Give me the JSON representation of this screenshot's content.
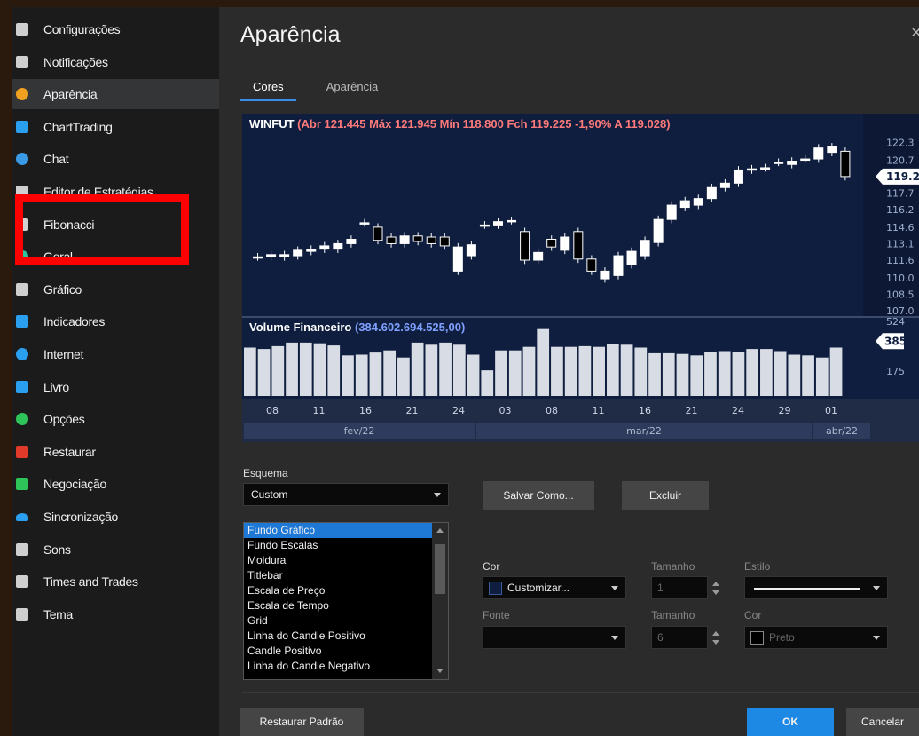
{
  "sidebar": {
    "items": [
      {
        "label": "Configurações",
        "icon": "gear-icon",
        "color": "#cfcfcf"
      },
      {
        "label": "Notificações",
        "icon": "alarm-clock-icon",
        "color": "#cfcfcf"
      },
      {
        "label": "Aparência",
        "icon": "palette-icon",
        "color": "#f0a020",
        "active": true
      },
      {
        "label": "ChartTrading",
        "icon": "chart-trading-icon",
        "color": "#2a9ff0"
      },
      {
        "label": "Chat",
        "icon": "chat-icon",
        "color": "#3a9ae6"
      },
      {
        "label": "Editor de Estratégias",
        "icon": "strategy-editor-icon",
        "color": "#cfcfcf"
      },
      {
        "label": "Fibonacci",
        "icon": "fibonacci-icon",
        "color": "#d0d0d0"
      },
      {
        "label": "Geral",
        "icon": "general-icon",
        "color": "#2ec4a0"
      },
      {
        "label": "Gráfico",
        "icon": "chart-icon",
        "color": "#cfcfcf"
      },
      {
        "label": "Indicadores",
        "icon": "indicators-icon",
        "color": "#2a9ff0"
      },
      {
        "label": "Internet",
        "icon": "globe-icon",
        "color": "#2a9ff0"
      },
      {
        "label": "Livro",
        "icon": "book-icon",
        "color": "#2a9ff0"
      },
      {
        "label": "Opções",
        "icon": "options-icon",
        "color": "#2ec45a"
      },
      {
        "label": "Restaurar",
        "icon": "restore-icon",
        "color": "#e03a2a"
      },
      {
        "label": "Negociação",
        "icon": "trade-icon",
        "color": "#2ec45a"
      },
      {
        "label": "Sincronização",
        "icon": "cloud-icon",
        "color": "#2a9ff0"
      },
      {
        "label": "Sons",
        "icon": "speaker-icon",
        "color": "#cfcfcf"
      },
      {
        "label": "Times and Trades",
        "icon": "times-trades-icon",
        "color": "#cfcfcf"
      },
      {
        "label": "Tema",
        "icon": "monitor-icon",
        "color": "#cfcfcf"
      }
    ]
  },
  "main": {
    "title": "Aparência",
    "close": "×",
    "tabs": [
      {
        "label": "Cores",
        "active": true
      },
      {
        "label": "Aparência",
        "active": false
      }
    ]
  },
  "chart_data": [
    {
      "type": "candlestick",
      "title_symbol": "WINFUT",
      "title_text": "(Abr 121.445 Máx 121.945 Mín 118.800 Fch 119.225 -1,90% A 119.028)",
      "y_ticks": [
        "122.3",
        "120.7",
        "117.7",
        "116.2",
        "114.6",
        "113.1",
        "111.6",
        "110.0",
        "108.5",
        "107.0"
      ],
      "y_current": "119.2",
      "ylim": [
        107.0,
        122.5
      ],
      "candles": [
        {
          "o": 111.9,
          "c": 111.9
        },
        {
          "o": 111.9,
          "c": 112.1
        },
        {
          "o": 111.9,
          "c": 112.1
        },
        {
          "o": 112.0,
          "c": 112.5
        },
        {
          "o": 112.4,
          "c": 112.6
        },
        {
          "o": 112.6,
          "c": 112.9
        },
        {
          "o": 112.6,
          "c": 113.1
        },
        {
          "o": 113.1,
          "c": 113.5
        },
        {
          "o": 115.0,
          "c": 115.0
        },
        {
          "o": 114.6,
          "c": 113.4
        },
        {
          "o": 113.7,
          "c": 113.1
        },
        {
          "o": 113.1,
          "c": 113.8
        },
        {
          "o": 113.8,
          "c": 113.3
        },
        {
          "o": 113.7,
          "c": 113.1
        },
        {
          "o": 113.7,
          "c": 112.9
        },
        {
          "o": 110.6,
          "c": 112.8
        },
        {
          "o": 112.0,
          "c": 113.0
        },
        {
          "o": 114.8,
          "c": 114.8
        },
        {
          "o": 114.8,
          "c": 115.1
        },
        {
          "o": 115.2,
          "c": 115.2
        },
        {
          "o": 114.2,
          "c": 111.6
        },
        {
          "o": 111.6,
          "c": 112.3
        },
        {
          "o": 113.5,
          "c": 112.8
        },
        {
          "o": 112.5,
          "c": 113.7
        },
        {
          "o": 114.2,
          "c": 111.7
        },
        {
          "o": 111.7,
          "c": 110.6
        },
        {
          "o": 109.9,
          "c": 110.6
        },
        {
          "o": 110.2,
          "c": 112.0
        },
        {
          "o": 111.2,
          "c": 112.4
        },
        {
          "o": 112.0,
          "c": 113.4
        },
        {
          "o": 113.2,
          "c": 115.3
        },
        {
          "o": 115.3,
          "c": 116.6
        },
        {
          "o": 116.4,
          "c": 117.0
        },
        {
          "o": 116.6,
          "c": 117.2
        },
        {
          "o": 117.2,
          "c": 118.2
        },
        {
          "o": 118.2,
          "c": 118.6
        },
        {
          "o": 118.6,
          "c": 119.8
        },
        {
          "o": 119.8,
          "c": 119.9
        },
        {
          "o": 120.0,
          "c": 120.0
        },
        {
          "o": 120.5,
          "c": 120.5
        },
        {
          "o": 120.3,
          "c": 120.6
        },
        {
          "o": 120.8,
          "c": 120.8
        },
        {
          "o": 120.8,
          "c": 121.8
        },
        {
          "o": 121.4,
          "c": 121.9
        },
        {
          "o": 121.5,
          "c": 119.2
        }
      ]
    },
    {
      "type": "bar",
      "title_name": "Volume Financeiro",
      "title_value": "(384.602.694.525,00)",
      "y_ticks": [
        "524",
        "175"
      ],
      "y_current": "385",
      "ylim": [
        0,
        524
      ],
      "values": [
        340,
        330,
        350,
        375,
        375,
        370,
        355,
        285,
        290,
        305,
        320,
        270,
        375,
        360,
        375,
        360,
        290,
        180,
        320,
        320,
        345,
        470,
        345,
        345,
        350,
        345,
        365,
        360,
        340,
        300,
        300,
        295,
        285,
        310,
        315,
        310,
        330,
        330,
        315,
        290,
        285,
        270,
        340,
        0
      ]
    }
  ],
  "x_ticks": [
    "08",
    "11",
    "16",
    "21",
    "24",
    "03",
    "08",
    "11",
    "16",
    "21",
    "24",
    "29",
    "01"
  ],
  "x_months": [
    "fev/22",
    "mar/22",
    "abr/22"
  ],
  "colors": {
    "accent": "#1e78d6",
    "chart_bg": "#0f1e3e",
    "candle_up": "#ffffff",
    "candle_down": "#000000",
    "volume_bar": "#d8dce4",
    "price_label": "#ff6a6a",
    "ok_button": "#1e88e5"
  },
  "form": {
    "schema_label": "Esquema",
    "schema_value": "Custom",
    "save_as": "Salvar Como...",
    "delete": "Excluir",
    "list_items": [
      "Fundo Gráfico",
      "Fundo Escalas",
      "Moldura",
      "Titlebar",
      "Escala de Preço",
      "Escala de Tempo",
      "Grid",
      "Linha do Candle Positivo",
      "Candle Positivo",
      "Linha do Candle Negativo"
    ],
    "color_label": "Cor",
    "color_value": "Customizar...",
    "size_label": "Tamanho",
    "size_value": "1",
    "style_label": "Estilo",
    "font_label": "Fonte",
    "font_size_label": "Tamanho",
    "font_size_value": "6",
    "font_color_label": "Cor",
    "font_color_value": "Preto"
  },
  "footer": {
    "restore": "Restaurar Padrão",
    "ok": "OK",
    "cancel": "Cancelar"
  }
}
